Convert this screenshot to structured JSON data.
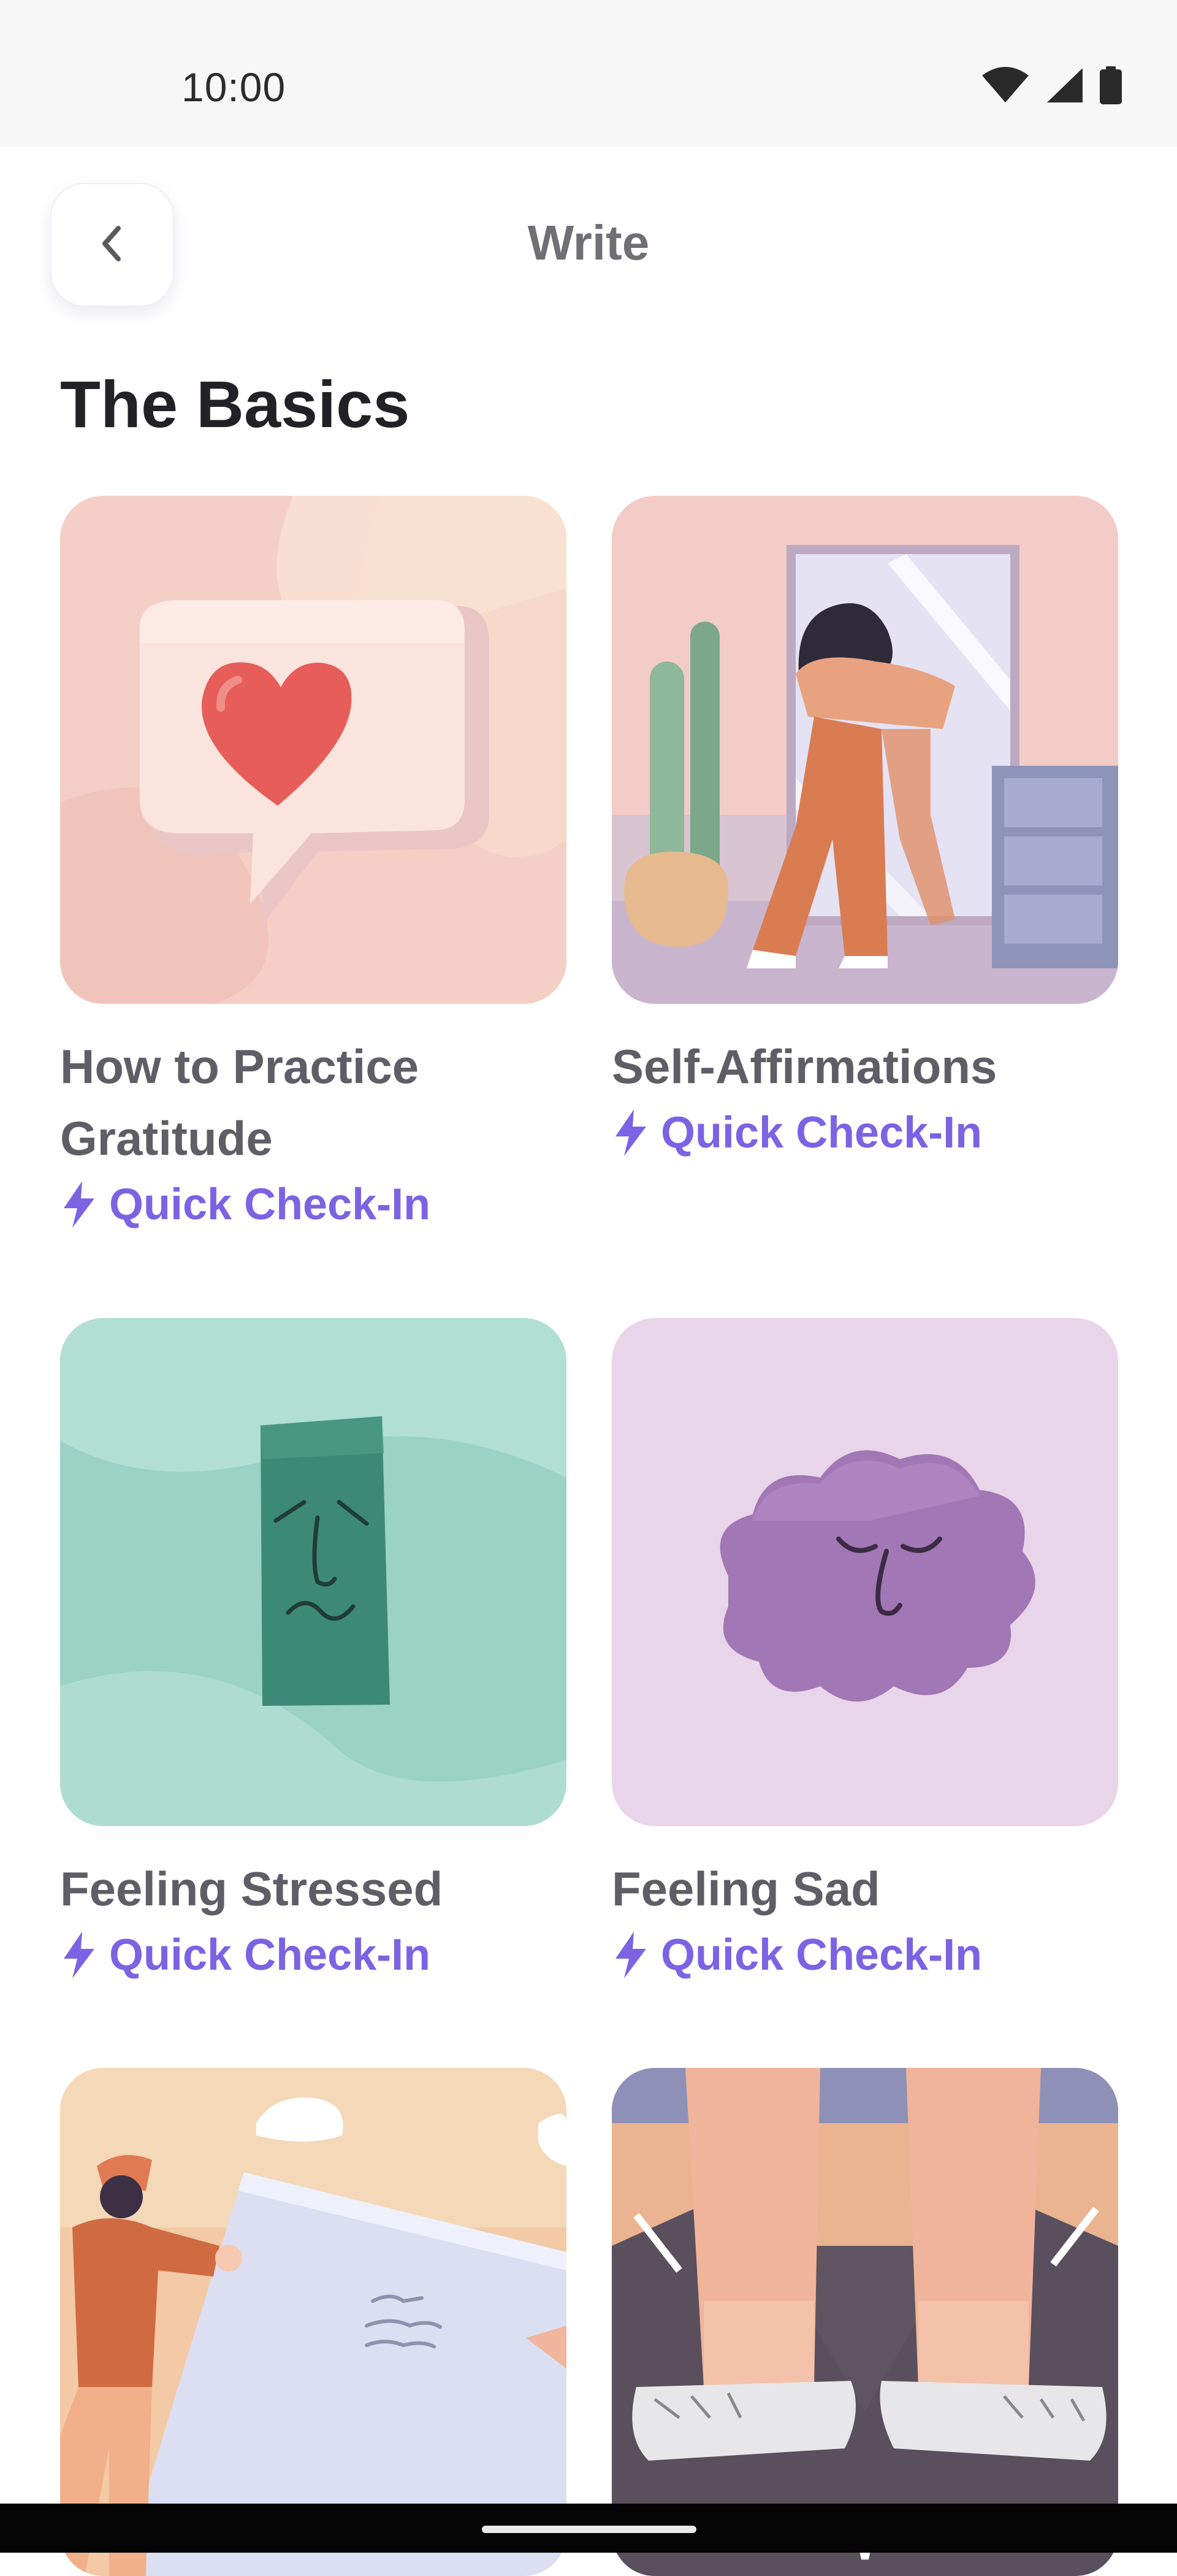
{
  "status_bar": {
    "time": "10:00",
    "icons": [
      "wifi-icon",
      "signal-icon",
      "battery-icon"
    ]
  },
  "header": {
    "back_icon": "chevron-left-icon",
    "title": "Write"
  },
  "section": {
    "title": "The Basics"
  },
  "cards": [
    {
      "title": "How to Practice Gratitude",
      "tag": "Quick Check-In",
      "illustration": "heart-speech-bubble"
    },
    {
      "title": "Self-Affirmations",
      "tag": "Quick Check-In",
      "illustration": "person-hugging-mirror"
    },
    {
      "title": "Feeling Stressed",
      "tag": "Quick Check-In",
      "illustration": "stressed-green-block"
    },
    {
      "title": "Feeling Sad",
      "tag": "Quick Check-In",
      "illustration": "sad-purple-cloud"
    },
    {
      "title": "",
      "tag": "",
      "illustration": "person-writing-letter"
    },
    {
      "title": "",
      "tag": "",
      "illustration": "feet-on-road"
    }
  ],
  "colors": {
    "accent": "#7b63e3",
    "title_text": "#5f5e66",
    "heading_text": "#222226"
  }
}
